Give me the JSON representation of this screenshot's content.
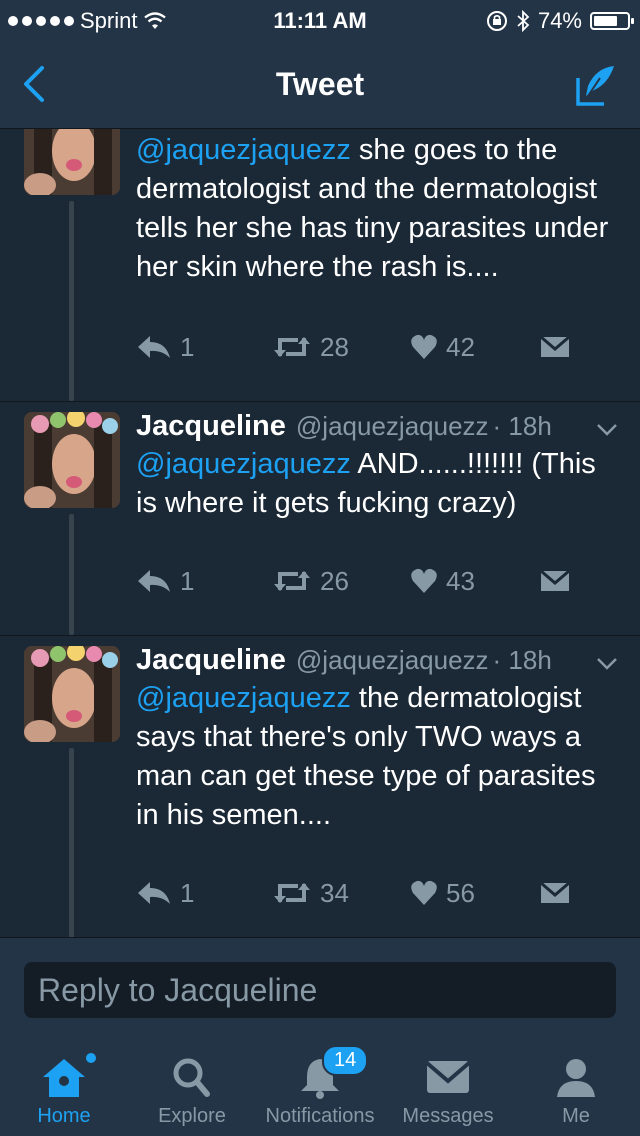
{
  "status": {
    "carrier": "Sprint",
    "time": "11:11 AM",
    "battery": "74%",
    "battery_level": 0.74
  },
  "nav": {
    "title": "Tweet"
  },
  "tweets": [
    {
      "name": "",
      "handle": "",
      "time": "",
      "mention": "@jaquezjaquezz",
      "text": " she goes to the dermatologist and the dermatologist tells her she has tiny parasites under her skin where the rash is....",
      "reply_count": "1",
      "retweets": "28",
      "likes": "42"
    },
    {
      "name": "Jacqueline",
      "handle": "@jaquezjaquezz",
      "time": "· 18h",
      "mention": "@jaquezjaquezz",
      "text": " AND......!!!!!!! (This is where it gets fucking crazy)",
      "reply_count": "1",
      "retweets": "26",
      "likes": "43"
    },
    {
      "name": "Jacqueline",
      "handle": "@jaquezjaquezz",
      "time": "· 18h",
      "mention": "@jaquezjaquezz",
      "text": " the dermatologist says that there's only TWO ways a man can get these type of parasites in his semen....",
      "reply_count": "1",
      "retweets": "34",
      "likes": "56"
    }
  ],
  "reply": {
    "placeholder": "Reply to Jacqueline"
  },
  "tabs": [
    {
      "label": "Home",
      "icon": "home-icon"
    },
    {
      "label": "Explore",
      "icon": "search-icon"
    },
    {
      "label": "Notifications",
      "icon": "bell-icon",
      "badge": "14"
    },
    {
      "label": "Messages",
      "icon": "envelope-icon"
    },
    {
      "label": "Me",
      "icon": "person-icon"
    }
  ],
  "colors": {
    "accent": "#1da1f2",
    "background": "#1b2836",
    "bar": "#243447",
    "muted": "#8899a6"
  }
}
